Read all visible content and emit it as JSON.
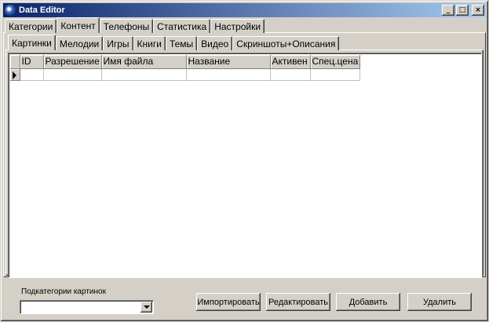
{
  "window": {
    "title": "Data Editor",
    "controls": {
      "minimize": "_",
      "maximize": "□",
      "close": "×"
    }
  },
  "tabs": [
    "Категории",
    "Контент",
    "Телефоны",
    "Статистика",
    "Настройки"
  ],
  "active_tab": "Контент",
  "subtabs": [
    "Картинки",
    "Мелодии",
    "Игры",
    "Книги",
    "Темы",
    "Видео",
    "Скриншоты+Описания"
  ],
  "active_subtab": "Картинки",
  "grid": {
    "columns": [
      "ID",
      "Разрешение",
      "Имя файла",
      "Название",
      "Активен",
      "Спец.цена"
    ]
  },
  "subcategory": {
    "label": "Подкатегории картинок",
    "value": ""
  },
  "buttons": {
    "import": "Импортировать",
    "edit": "Редактировать",
    "add": "Добавить",
    "delete": "Удалить"
  }
}
